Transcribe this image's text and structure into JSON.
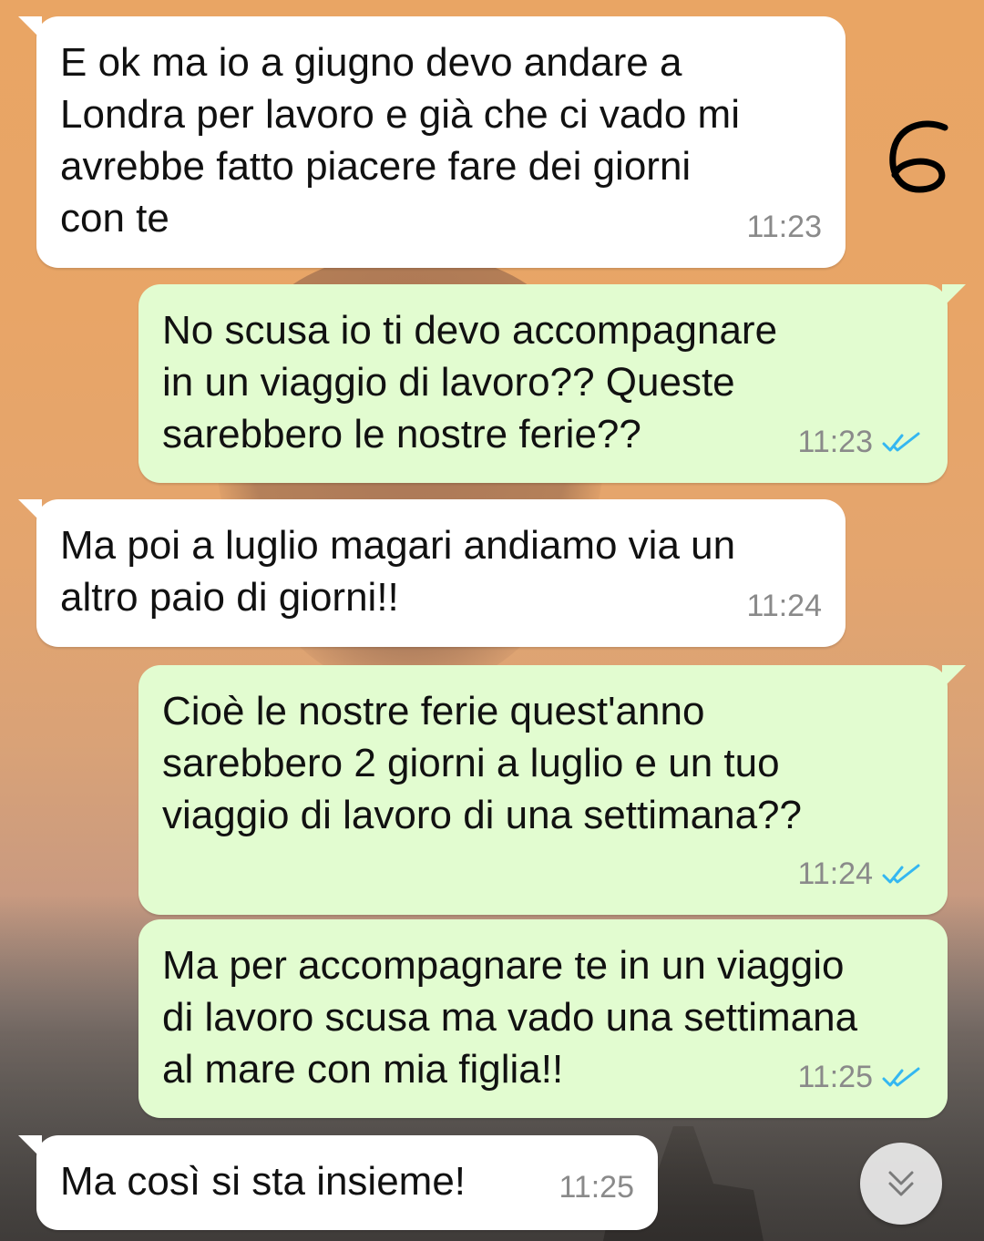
{
  "colors": {
    "incoming_bubble": "#ffffff",
    "outgoing_bubble": "#e2fcd0",
    "read_ticks": "#34b7f1",
    "timestamp": "#8a8a8a"
  },
  "annotation": {
    "text": "6"
  },
  "messages": [
    {
      "direction": "incoming",
      "text": "E ok ma io a giugno devo andare a\nLondra per lavoro e già che ci vado mi\navrebbe fatto piacere fare dei giorni\ncon te",
      "time": "11:23"
    },
    {
      "direction": "outgoing",
      "text": "No scusa io ti devo accompagnare\nin un viaggio di lavoro?? Queste\nsarebbero le nostre ferie??",
      "time": "11:23",
      "status_icon": "double-check-read"
    },
    {
      "direction": "incoming",
      "text": "Ma poi a luglio magari andiamo via un\naltro paio di giorni!!",
      "time": "11:24"
    },
    {
      "direction": "outgoing",
      "text": "Cioè le nostre ferie quest'anno\nsarebbero 2 giorni a luglio e un tuo\nviaggio di lavoro di una settimana??",
      "time": "11:24",
      "status_icon": "double-check-read"
    },
    {
      "direction": "outgoing",
      "text": "Ma per accompagnare te in un viaggio\ndi lavoro scusa ma vado una settimana\nal mare con mia figlia!!",
      "time": "11:25",
      "status_icon": "double-check-read"
    },
    {
      "direction": "incoming",
      "text": "Ma così si sta insieme!",
      "time": "11:25"
    }
  ],
  "scroll_button": {
    "icon": "double-chevron-down-icon"
  }
}
